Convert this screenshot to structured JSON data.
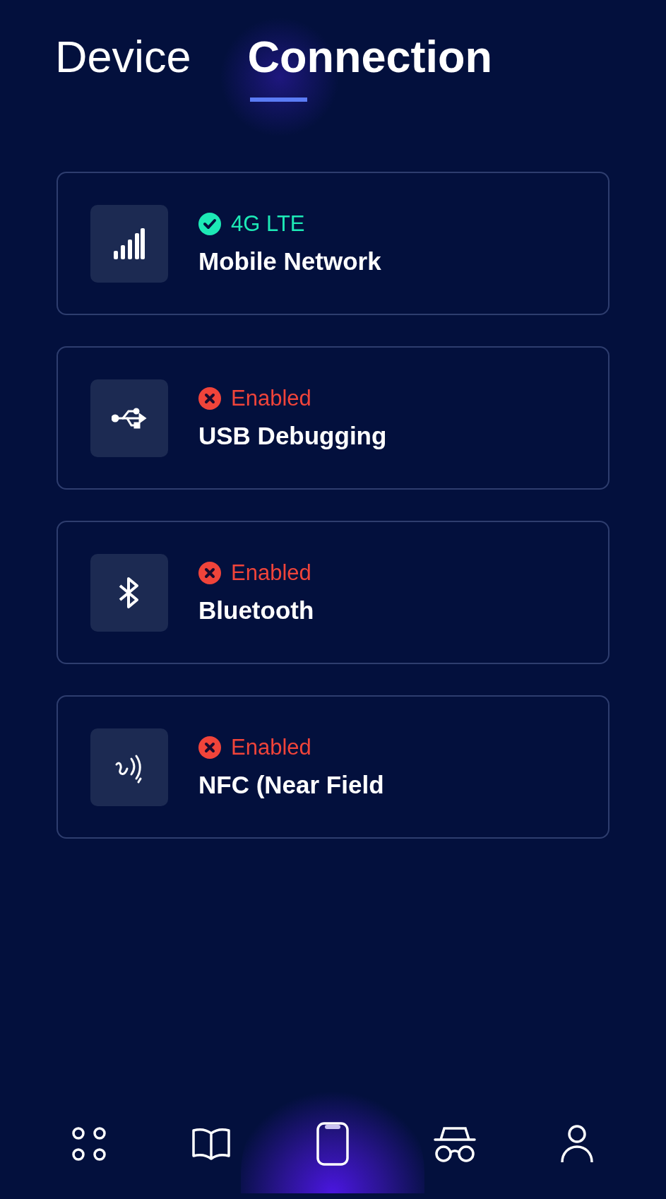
{
  "tabs": [
    {
      "label": "Device",
      "selected": false
    },
    {
      "label": "Connection",
      "selected": true
    }
  ],
  "connections": [
    {
      "kind": "signal",
      "ok": true,
      "status_text": "4G LTE",
      "title": "Mobile Network"
    },
    {
      "kind": "usb",
      "ok": false,
      "status_text": "Enabled",
      "title": "USB Debugging"
    },
    {
      "kind": "bluetooth",
      "ok": false,
      "status_text": "Enabled",
      "title": "Bluetooth"
    },
    {
      "kind": "nfc",
      "ok": false,
      "status_text": "Enabled",
      "title": "NFC (Near Field"
    }
  ],
  "nav": [
    {
      "kind": "apps",
      "selected": false
    },
    {
      "kind": "book",
      "selected": false
    },
    {
      "kind": "phone",
      "selected": true
    },
    {
      "kind": "incognito",
      "selected": false
    },
    {
      "kind": "user",
      "selected": false
    }
  ]
}
